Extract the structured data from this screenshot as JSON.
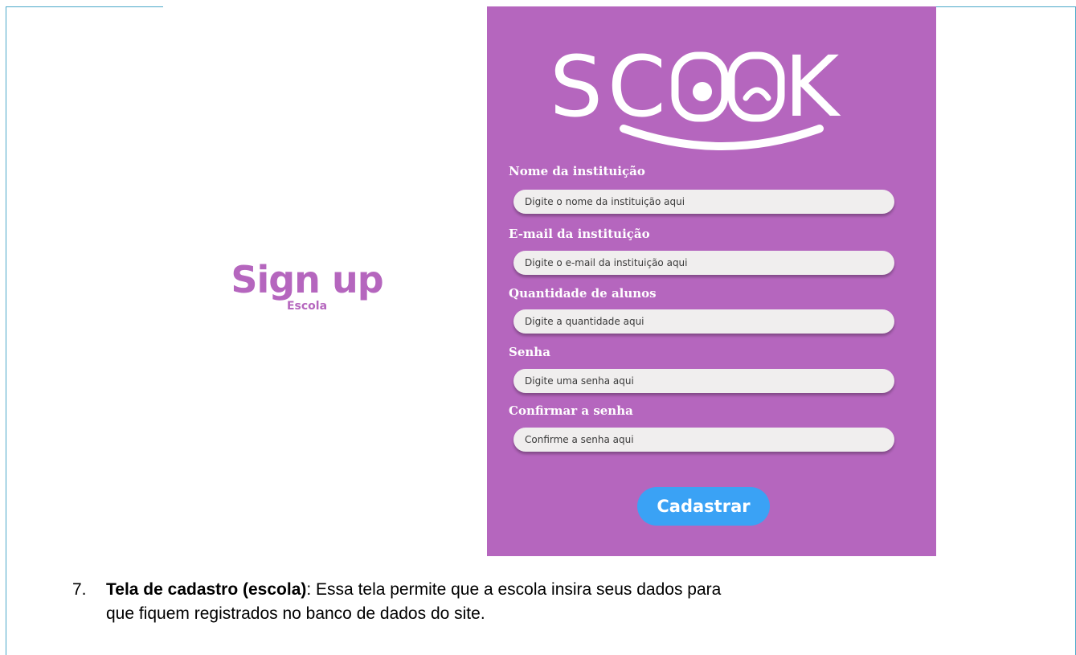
{
  "heading": {
    "title": "Sign up",
    "subtitle": "Escola"
  },
  "panel": {
    "logo_text": "SCOOK",
    "background_color": "#b566be",
    "fields": [
      {
        "label": "Nome da instituição",
        "placeholder": "Digite o nome da instituição aqui"
      },
      {
        "label": "E-mail da instituição",
        "placeholder": "Digite o e-mail da instituição aqui"
      },
      {
        "label": "Quantidade de alunos",
        "placeholder": "Digite a quantidade aqui"
      },
      {
        "label": "Senha",
        "placeholder": "Digite uma senha aqui"
      },
      {
        "label": "Confirmar a senha",
        "placeholder": "Confirme a senha aqui"
      }
    ],
    "submit_label": "Cadastrar",
    "submit_color": "#3aa2f5"
  },
  "caption": {
    "number": "7.",
    "bold": "Tela de cadastro (escola)",
    "text_line1": ": Essa tela permite que a escola insira seus dados para",
    "text_line2": "que fiquem registrados no banco de dados do site."
  }
}
